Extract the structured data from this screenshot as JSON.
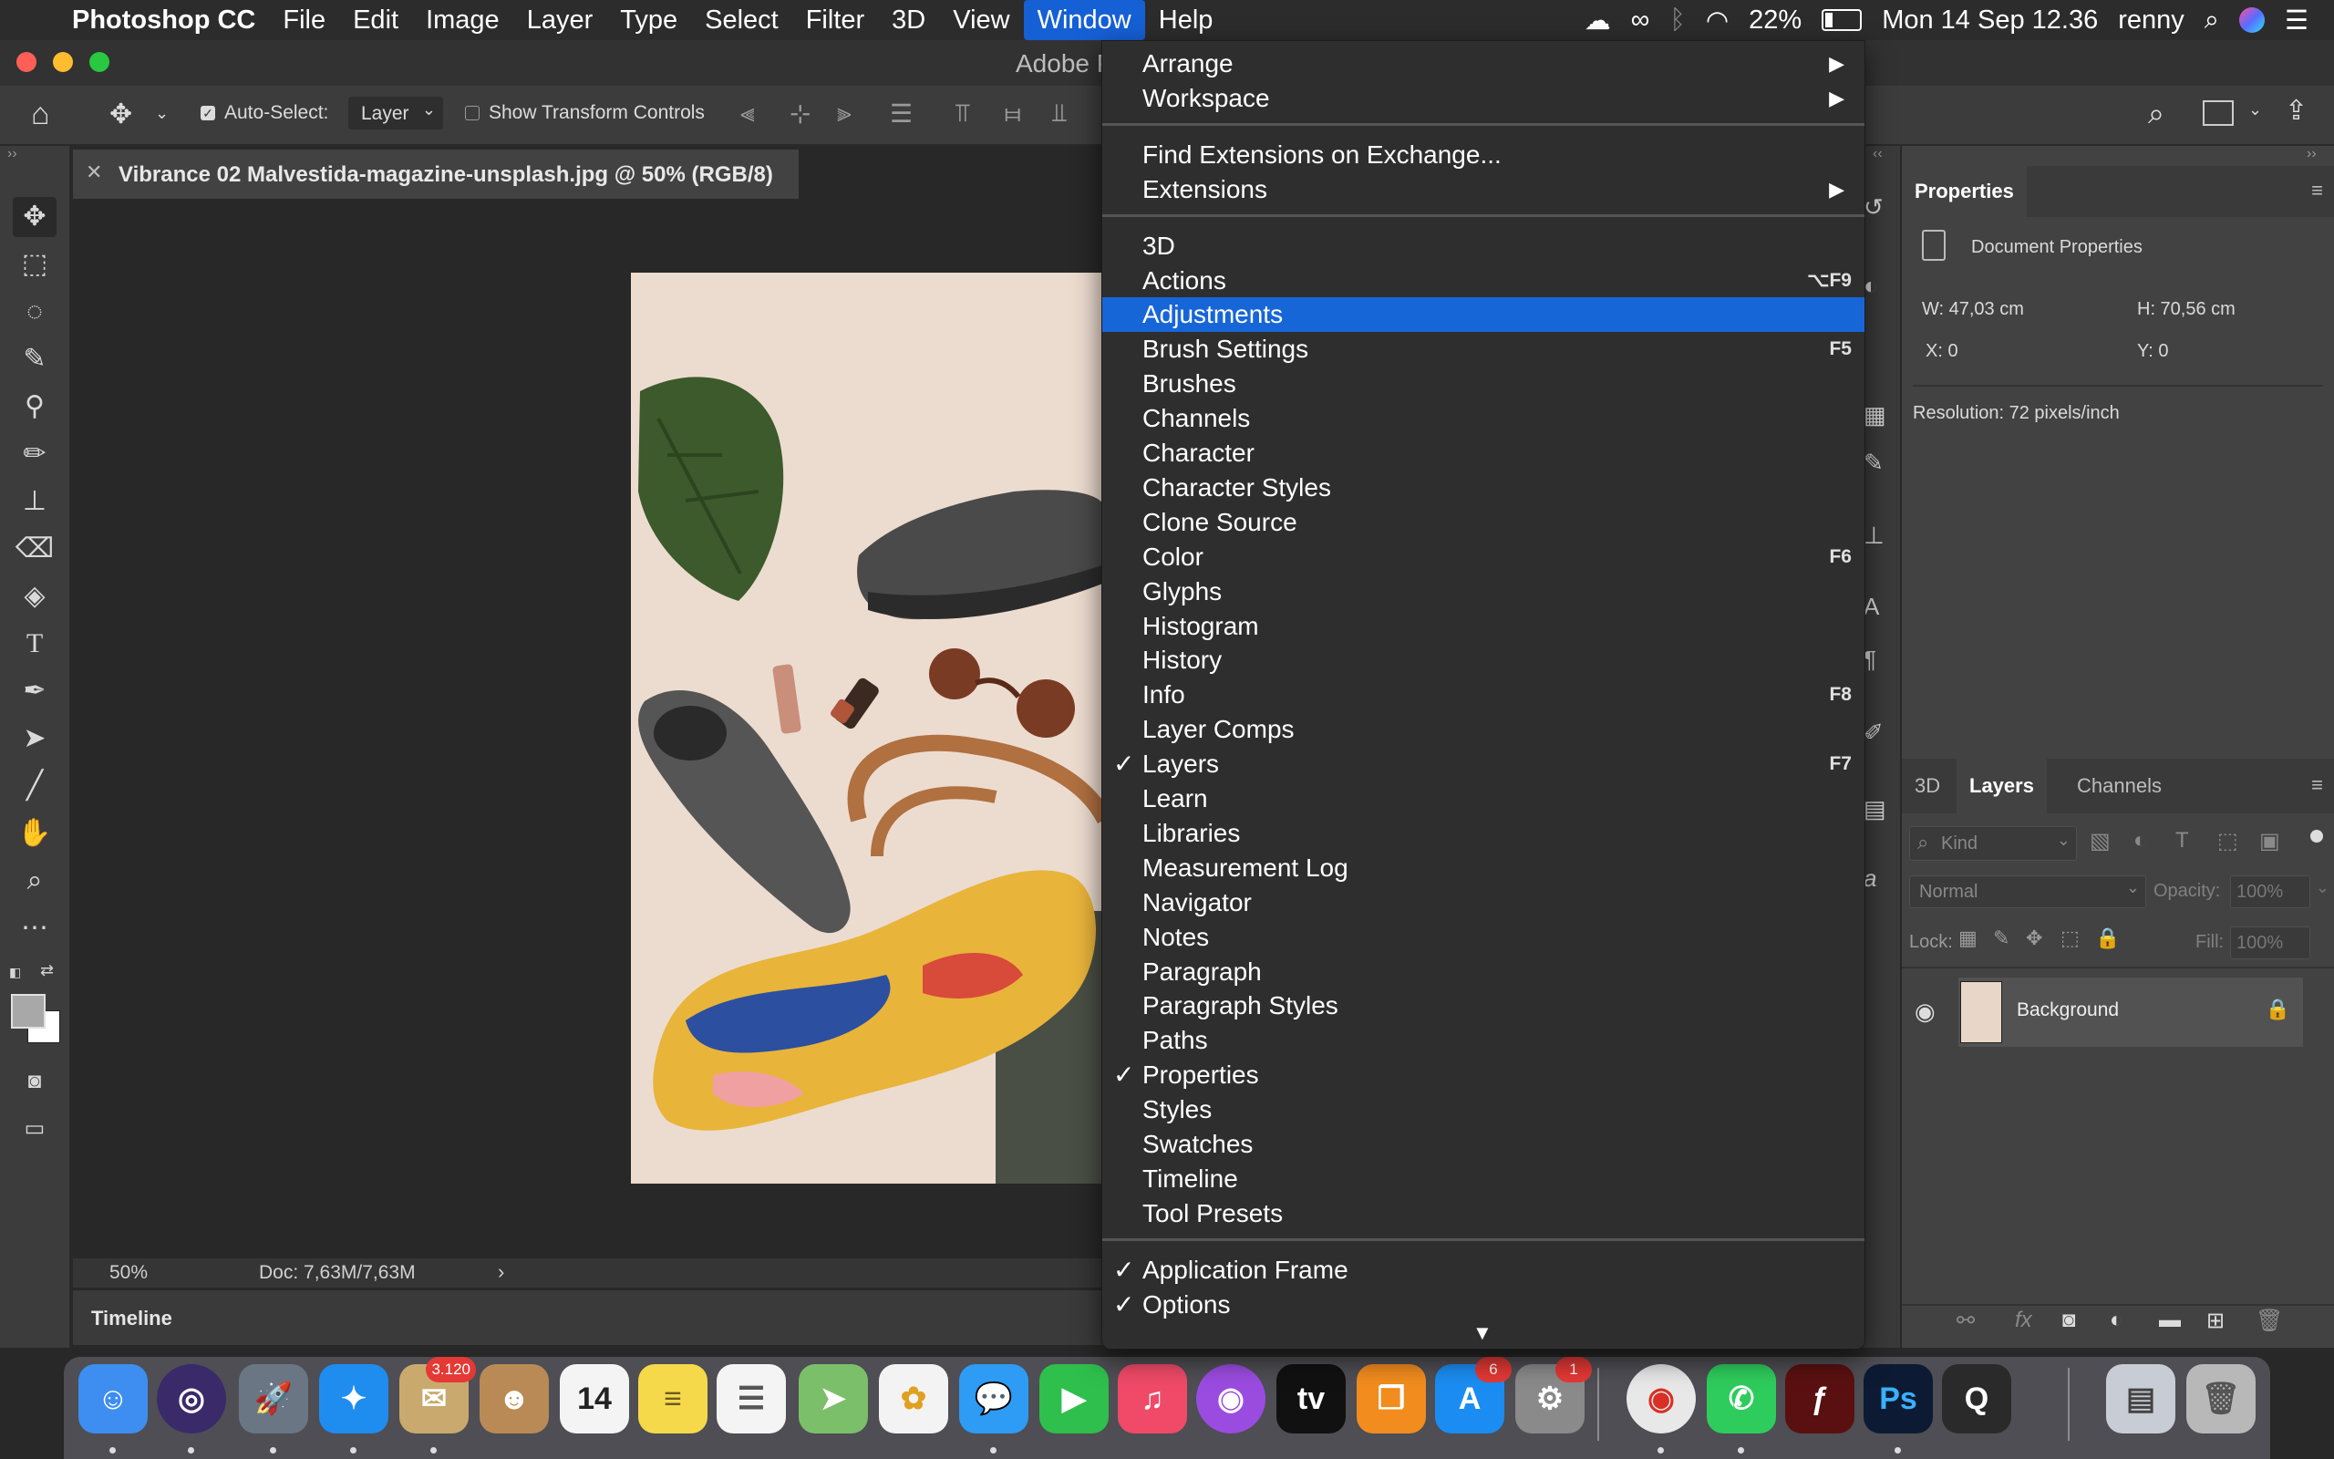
{
  "menubar": {
    "app_name": "Photoshop CC",
    "items": [
      "File",
      "Edit",
      "Image",
      "Layer",
      "Type",
      "Select",
      "Filter",
      "3D",
      "View",
      "Window",
      "Help"
    ],
    "active_item": "Window",
    "battery": "22%",
    "datetime": "Mon 14 Sep  12.36",
    "user": "renny"
  },
  "window": {
    "title": "Adobe P"
  },
  "options_bar": {
    "auto_select_label": "Auto-Select:",
    "auto_select_checked": true,
    "target_value": "Layer",
    "show_transform_label": "Show Transform Controls",
    "show_transform_checked": false
  },
  "document": {
    "tab_title": "Vibrance 02 Malvestida-magazine-unsplash.jpg @ 50% (RGB/8)",
    "zoom": "50%",
    "doc_size": "Doc: 7,63M/7,63M"
  },
  "timeline": {
    "label": "Timeline"
  },
  "properties": {
    "tab": "Properties",
    "section": "Document Properties",
    "width": "W:  47,03 cm",
    "height": "H:  70,56 cm",
    "x": "X:  0",
    "y": "Y:  0",
    "resolution": "Resolution: 72 pixels/inch"
  },
  "layers_panel": {
    "tabs": [
      "3D",
      "Layers",
      "Channels"
    ],
    "active_tab": "Layers",
    "filter_placeholder": "Kind",
    "blend_mode": "Normal",
    "opacity_label": "Opacity:",
    "opacity_value": "100%",
    "lock_label": "Lock:",
    "fill_label": "Fill:",
    "fill_value": "100%",
    "layers": [
      {
        "name": "Background",
        "visible": true,
        "locked": true
      }
    ]
  },
  "window_menu": {
    "groups": [
      [
        {
          "label": "Arrange",
          "submenu": true
        },
        {
          "label": "Workspace",
          "submenu": true
        }
      ],
      [
        {
          "label": "Find Extensions on Exchange..."
        },
        {
          "label": "Extensions",
          "submenu": true
        }
      ],
      [
        {
          "label": "3D"
        },
        {
          "label": "Actions",
          "shortcut": "⌥F9"
        },
        {
          "label": "Adjustments",
          "highlighted": true
        },
        {
          "label": "Brush Settings",
          "shortcut": "F5"
        },
        {
          "label": "Brushes"
        },
        {
          "label": "Channels"
        },
        {
          "label": "Character"
        },
        {
          "label": "Character Styles"
        },
        {
          "label": "Clone Source"
        },
        {
          "label": "Color",
          "shortcut": "F6"
        },
        {
          "label": "Glyphs"
        },
        {
          "label": "Histogram"
        },
        {
          "label": "History"
        },
        {
          "label": "Info",
          "shortcut": "F8"
        },
        {
          "label": "Layer Comps"
        },
        {
          "label": "Layers",
          "shortcut": "F7",
          "checked": true
        },
        {
          "label": "Learn"
        },
        {
          "label": "Libraries"
        },
        {
          "label": "Measurement Log"
        },
        {
          "label": "Navigator"
        },
        {
          "label": "Notes"
        },
        {
          "label": "Paragraph"
        },
        {
          "label": "Paragraph Styles"
        },
        {
          "label": "Paths"
        },
        {
          "label": "Properties",
          "checked": true
        },
        {
          "label": "Styles"
        },
        {
          "label": "Swatches"
        },
        {
          "label": "Timeline"
        },
        {
          "label": "Tool Presets"
        }
      ],
      [
        {
          "label": "Application Frame",
          "checked": true
        },
        {
          "label": "Options",
          "checked": true
        }
      ]
    ]
  },
  "dock": {
    "apps": [
      {
        "name": "finder-icon",
        "color": "#3d8ef0",
        "glyph": "☺"
      },
      {
        "name": "siri-icon",
        "color": "#3a2a6a",
        "glyph": "◎"
      },
      {
        "name": "launchpad-icon",
        "color": "#6b7684",
        "glyph": "🚀"
      },
      {
        "name": "safari-icon",
        "color": "#1f8cf0",
        "glyph": "✦"
      },
      {
        "name": "mail-icon",
        "color": "#c9a96e",
        "glyph": "✉",
        "badge": "3.120"
      },
      {
        "name": "contacts-icon",
        "color": "#b98a55",
        "glyph": "☻"
      },
      {
        "name": "calendar-icon",
        "color": "#f4f4f4",
        "glyph": "14",
        "text_color": "#222222"
      },
      {
        "name": "notes-icon",
        "color": "#f6d94a",
        "glyph": "≡",
        "text_color": "#6a5a20"
      },
      {
        "name": "reminders-icon",
        "color": "#f4f4f4",
        "glyph": "☰",
        "text_color": "#555555"
      },
      {
        "name": "maps-icon",
        "color": "#7bbf6a",
        "glyph": "➤"
      },
      {
        "name": "photos-icon",
        "color": "#f3f3f3",
        "glyph": "✿",
        "text_color": "#e0a020"
      },
      {
        "name": "messages-icon",
        "color": "#2e9bf5",
        "glyph": "💬"
      },
      {
        "name": "facetime-icon",
        "color": "#2fbf4c",
        "glyph": "▶"
      },
      {
        "name": "music-icon",
        "color": "#f04a68",
        "glyph": "♫"
      },
      {
        "name": "podcasts-icon",
        "color": "#9b4ce0",
        "glyph": "◉"
      },
      {
        "name": "apple-tv-icon",
        "color": "#111111",
        "glyph": "tv"
      },
      {
        "name": "books-icon",
        "color": "#f28c1e",
        "glyph": "❒"
      },
      {
        "name": "app-store-icon",
        "color": "#1b8df2",
        "glyph": "A",
        "badge": "6"
      },
      {
        "name": "system-preferences-icon",
        "color": "#8a8a8a",
        "glyph": "⚙",
        "badge": "1"
      },
      {
        "name": "chrome-icon",
        "color": "#e8e8e8",
        "glyph": "◉",
        "text_color": "#d93025"
      },
      {
        "name": "whatsapp-icon",
        "color": "#2ecc5c",
        "glyph": "✆"
      },
      {
        "name": "flash-icon",
        "color": "#5a1010",
        "glyph": "ƒ"
      },
      {
        "name": "photoshop-icon",
        "color": "#0c1b33",
        "glyph": "Ps",
        "text_color": "#3ab0ff"
      },
      {
        "name": "quicktime-icon",
        "color": "#2a2a2a",
        "glyph": "Q"
      },
      {
        "name": "preview-icon",
        "color": "#c8ccd4",
        "glyph": "▤",
        "text_color": "#444444"
      },
      {
        "name": "trash-icon",
        "color": "#b8b8b8",
        "glyph": "🗑",
        "text_color": "#555555"
      }
    ]
  }
}
